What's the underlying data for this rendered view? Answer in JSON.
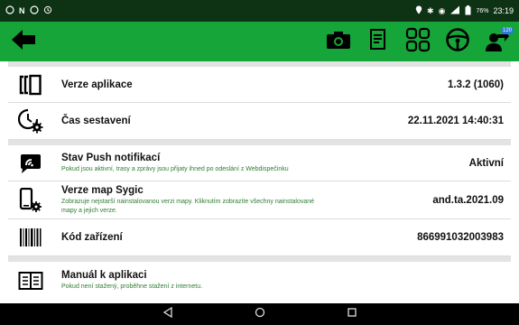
{
  "status_bar": {
    "left_icons": [
      "whatsapp-icon",
      "n-icon",
      "whatsapp-icon",
      "alarm-icon"
    ],
    "battery": "76%",
    "time": "23:19"
  },
  "toolbar": {
    "back_icon": "arrow-left-icon",
    "buttons": [
      "camera-icon",
      "document-icon",
      "tachograph-icon",
      "steering-wheel-icon",
      "driver-login-icon"
    ],
    "badge": "120"
  },
  "rows": [
    {
      "name": "app-version",
      "icon": "bracket-phone-icon",
      "title": "Verze aplikace",
      "description": "",
      "value": "1.3.2 (1060)"
    },
    {
      "name": "build-time",
      "icon": "clock-gear-icon",
      "title": "Čas sestavení",
      "description": "",
      "value": "22.11.2021 14:40:31"
    },
    {
      "name": "push-status",
      "icon": "chat-signal-icon",
      "title": "Stav Push notifikací",
      "description": "Pokud jsou aktivní, trasy a zprávy jsou přijaty ihned po odeslání z Webdispečinku",
      "value": "Aktivní"
    },
    {
      "name": "sygic-maps",
      "icon": "phone-gear-icon",
      "title": "Verze map Sygic",
      "description": "Zobrazuje nejstarší nainstalovanou verzi mapy. Kliknutím zobrazíte všechny nainstalované mapy a jejich verze.",
      "value": "and.ta.2021.09"
    },
    {
      "name": "device-code",
      "icon": "barcode-icon",
      "title": "Kód zařízení",
      "description": "",
      "value": "866991032003983"
    },
    {
      "name": "app-manual",
      "icon": "book-icon",
      "title": "Manuál k aplikaci",
      "description": "Pokud není stažený, proběhne stažení z internetu.",
      "value": ""
    }
  ],
  "nav_bar": [
    "back-triangle-icon",
    "home-circle-icon",
    "recents-square-icon"
  ]
}
